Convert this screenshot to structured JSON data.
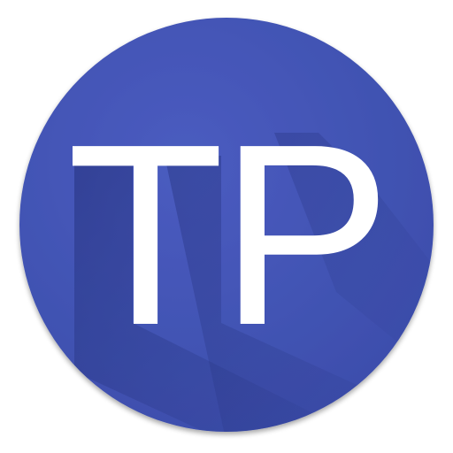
{
  "app_icon": {
    "letters": "TP",
    "colors": {
      "circle_base": "#4152b3",
      "circle_highlight": "#4a5cc0",
      "long_shadow": "#2c3a8f",
      "letters": "#ffffff"
    }
  }
}
